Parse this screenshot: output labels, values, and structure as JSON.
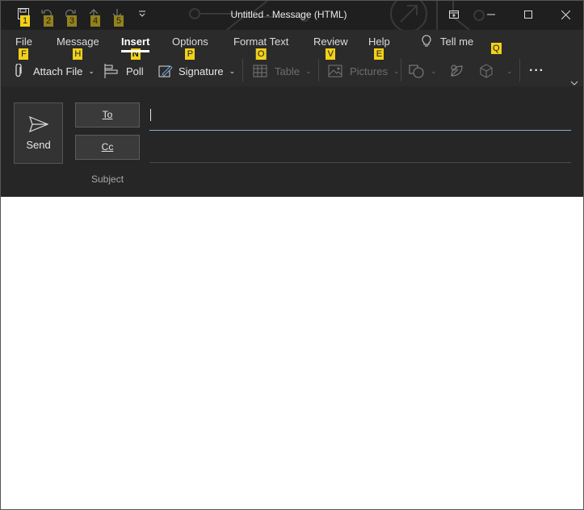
{
  "window": {
    "title": "Untitled  -  Message (HTML)"
  },
  "quick_access": {
    "keytips": [
      "1",
      "2",
      "3",
      "4",
      "5"
    ]
  },
  "tabs": [
    {
      "label": "File",
      "keytip": "F",
      "active": false
    },
    {
      "label": "Message",
      "keytip": "H",
      "active": false
    },
    {
      "label": "Insert",
      "keytip": "N",
      "active": true
    },
    {
      "label": "Options",
      "keytip": "P",
      "active": false
    },
    {
      "label": "Format Text",
      "keytip": "O",
      "active": false
    },
    {
      "label": "Review",
      "keytip": "V",
      "active": false
    },
    {
      "label": "Help",
      "keytip": "E",
      "active": false
    }
  ],
  "tell_me": {
    "label": "Tell me",
    "keytip": "Q"
  },
  "ribbon_commands": {
    "attach_file": "Attach File",
    "poll": "Poll",
    "signature": "Signature",
    "table": "Table",
    "pictures": "Pictures",
    "more": "···"
  },
  "compose": {
    "send_label": "Send",
    "to_label": "To",
    "cc_label": "Cc",
    "subject_label": "Subject",
    "to_value": "",
    "cc_value": ""
  },
  "colors": {
    "titlebar_bg": "#1f1f1f",
    "ribbon_bg": "#2b2b2b",
    "compose_bg": "#262626",
    "keytip_bg": "#f2d11a"
  }
}
